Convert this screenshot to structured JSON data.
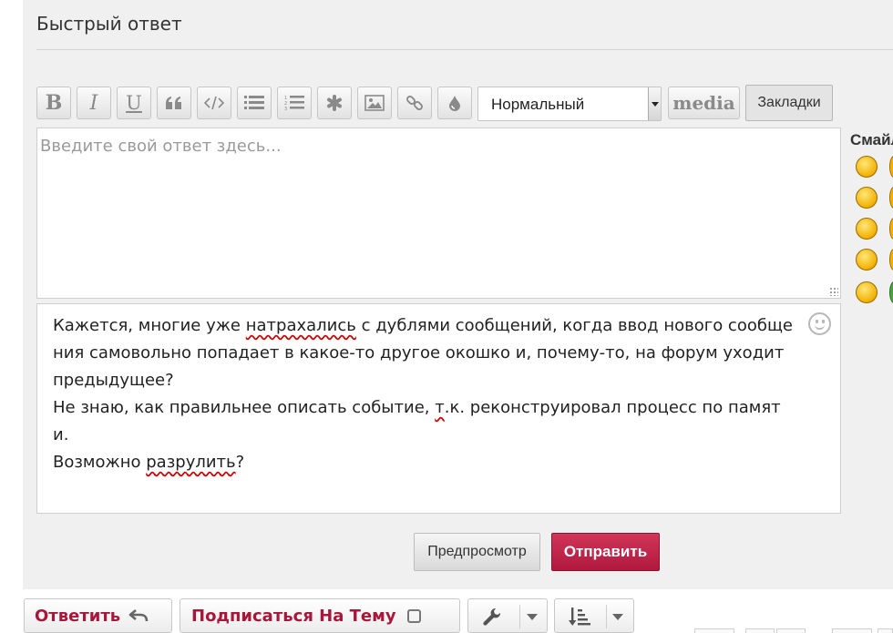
{
  "page": {
    "title": "Быстрый ответ"
  },
  "toolbar": {
    "size_select": {
      "value": "Нормальный"
    },
    "media_label": "media",
    "bookmarks_label": "Закладки"
  },
  "reply_editor": {
    "placeholder": "Введите свой ответ здесь..."
  },
  "smilies": {
    "title": "Смайлики"
  },
  "post_text": {
    "lines": [
      [
        "Кажется, многие уже ",
        "натрахались",
        " с дублями сообщений, когда ввод нового сообще"
      ],
      [
        "ния самовольно попадает в какое-то другое окошко и, почему-то, на форум уходит"
      ],
      [
        "предыдущее?"
      ],
      [
        "Не знаю, как правильнее описать событие, ",
        "т",
        ".к. реконструировал процесс по памят"
      ],
      [
        "и."
      ],
      [
        "Возможно ",
        "разрулить",
        "?"
      ]
    ]
  },
  "actions": {
    "preview_label": "Предпросмотр",
    "send_label": "Отправить"
  },
  "topic_actions": {
    "reply_label": "Ответить",
    "subscribe_label": "Подписаться На Тему"
  },
  "colors": {
    "accent": "#b0183e",
    "panel_bg": "#f0f0f0"
  }
}
